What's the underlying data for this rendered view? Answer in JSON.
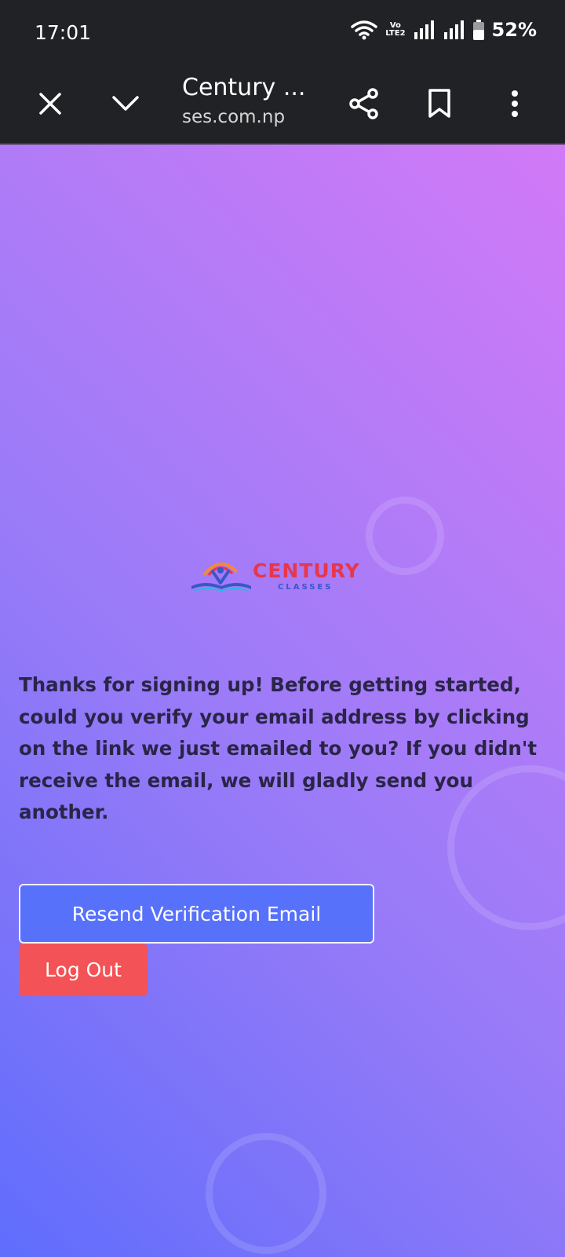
{
  "status_bar": {
    "time": "17:01",
    "volte_line1": "Vo",
    "volte_line2": "LTE2",
    "battery": "52%"
  },
  "browser": {
    "title": "Century ...",
    "url": "ses.com.np",
    "icons": [
      "close-icon",
      "chevron-down-icon",
      "share-icon",
      "bookmark-icon",
      "more-vert-icon"
    ]
  },
  "page": {
    "logo": {
      "word": "CENTURY",
      "sub": "CLASSES"
    },
    "message": "Thanks for signing up! Before getting started, could you verify your email address by clicking on the link we just emailed to you? If you didn't receive the email, we will gladly send you another.",
    "resend_button": "Resend Verification Email",
    "logout_button": "Log Out"
  },
  "colors": {
    "accent_button": "#5771fb",
    "logout_button": "#f35256",
    "text": "#2a2548",
    "logo_red": "#e8364a",
    "logo_blue": "#3a56c8"
  }
}
